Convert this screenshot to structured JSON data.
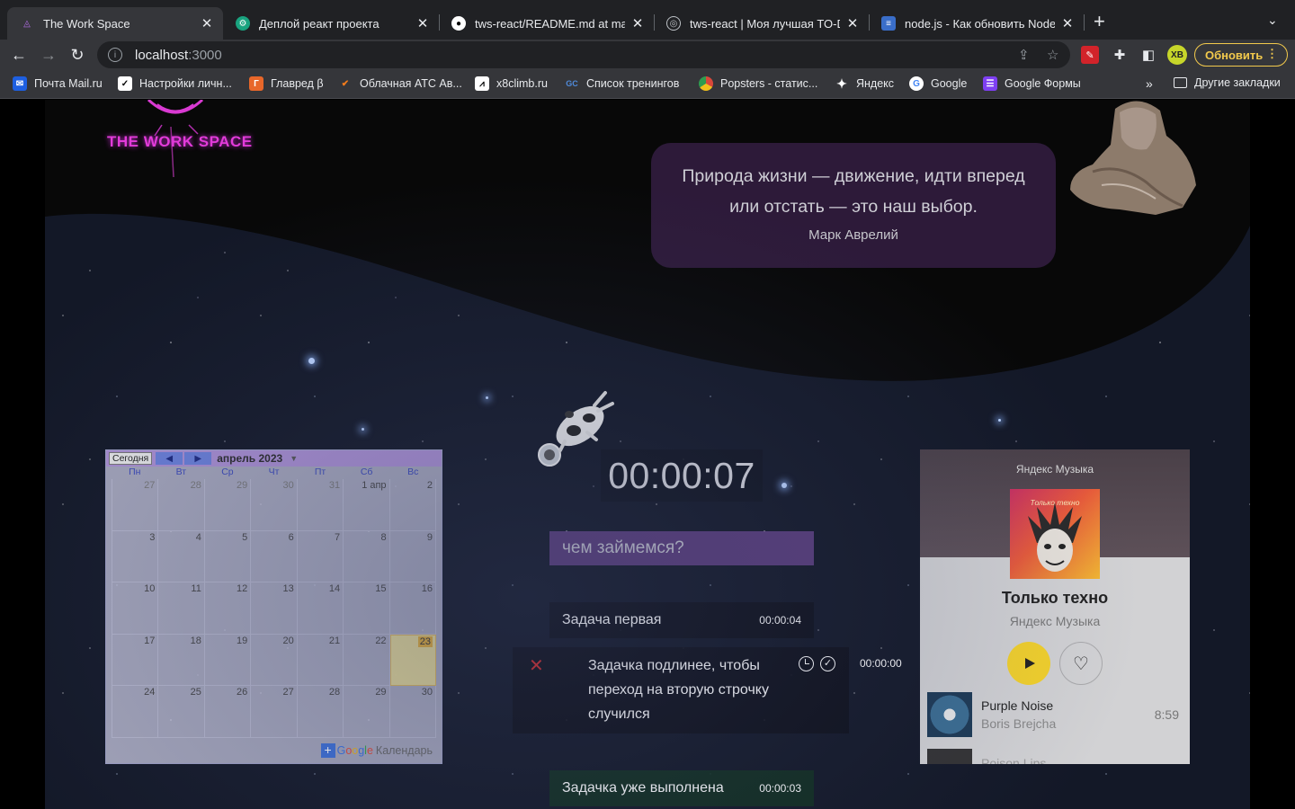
{
  "browser": {
    "tabs": [
      {
        "title": "The Work Space",
        "active": true
      },
      {
        "title": "Деплой реакт проекта",
        "active": false
      },
      {
        "title": "tws-react/README.md at mast",
        "active": false
      },
      {
        "title": "tws-react | Моя лучшая TO-DO",
        "active": false
      },
      {
        "title": "node.js - Как обновить NodeJ",
        "active": false
      }
    ],
    "url_host": "localhost",
    "url_port": ":3000",
    "profile_initials": "XB",
    "update_label": "Обновить",
    "bookmarks": [
      {
        "label": "Почта Mail.ru",
        "icon": "mail-icon",
        "color": "#1e5fe0"
      },
      {
        "label": "Настройки личн...",
        "icon": "check-icon",
        "color": "#ffffff"
      },
      {
        "label": "Главред β",
        "icon": "glavred-icon",
        "color": "#e8672a"
      },
      {
        "label": "Облачная АТС Ав...",
        "icon": "ats-icon",
        "color": "#f07b1c"
      },
      {
        "label": "x8climb.ru",
        "icon": "mountain-icon",
        "color": "#ffffff"
      },
      {
        "label": "Список тренингов",
        "icon": "gc-icon",
        "color": "#4f8ad9"
      },
      {
        "label": "Popsters - статис...",
        "icon": "chrome-icon",
        "color": "#d9483b"
      },
      {
        "label": "Яндекс",
        "icon": "star-icon",
        "color": "#ffffff"
      },
      {
        "label": "Google",
        "icon": "google-icon",
        "color": "#ffffff"
      },
      {
        "label": "Google Формы",
        "icon": "forms-icon",
        "color": "#7e3ff2"
      }
    ],
    "other_bookmarks": "Другие закладки"
  },
  "page": {
    "logo_text": "THE WORK SPACE",
    "quote": {
      "line1": "Природа жизни — движение, идти вперед",
      "line2": "или отстать — это наш выбор.",
      "author": "Марк Аврелий"
    },
    "timer": "00:00:07",
    "task_input_placeholder": "чем займемся?",
    "tasks": [
      {
        "text": "Задача первая",
        "time": "00:00:04",
        "state": "normal"
      },
      {
        "text": "Задачка подлинее, чтобы переход на вторую строчку случился",
        "time": "00:00:00",
        "state": "editing"
      },
      {
        "text": "Задачка уже выполнена",
        "time": "00:00:03",
        "state": "done"
      }
    ],
    "calendar": {
      "today_label": "Сегодня",
      "month": "апрель 2023",
      "weekdays": [
        "Пн",
        "Вт",
        "Ср",
        "Чт",
        "Пт",
        "Сб",
        "Вс"
      ],
      "weeks": [
        [
          "27",
          "28",
          "29",
          "30",
          "31",
          "1 апр",
          "2"
        ],
        [
          "3",
          "4",
          "5",
          "6",
          "7",
          "8",
          "9"
        ],
        [
          "10",
          "11",
          "12",
          "13",
          "14",
          "15",
          "16"
        ],
        [
          "17",
          "18",
          "19",
          "20",
          "21",
          "22",
          "23"
        ],
        [
          "24",
          "25",
          "26",
          "27",
          "28",
          "29",
          "30"
        ]
      ],
      "today": "23",
      "footer_google": "Google",
      "footer_word": "Календарь"
    },
    "music": {
      "brand": "Яндекс Музыка",
      "cover_caption": "Только техно",
      "playlist_title": "Только техно",
      "playlist_sub": "Яндекс Музыка",
      "tracks": [
        {
          "name": "Purple Noise",
          "artist": "Boris Brejcha",
          "duration": "8:59"
        },
        {
          "name": "Poison Lips",
          "artist": "",
          "duration": ""
        }
      ]
    }
  }
}
